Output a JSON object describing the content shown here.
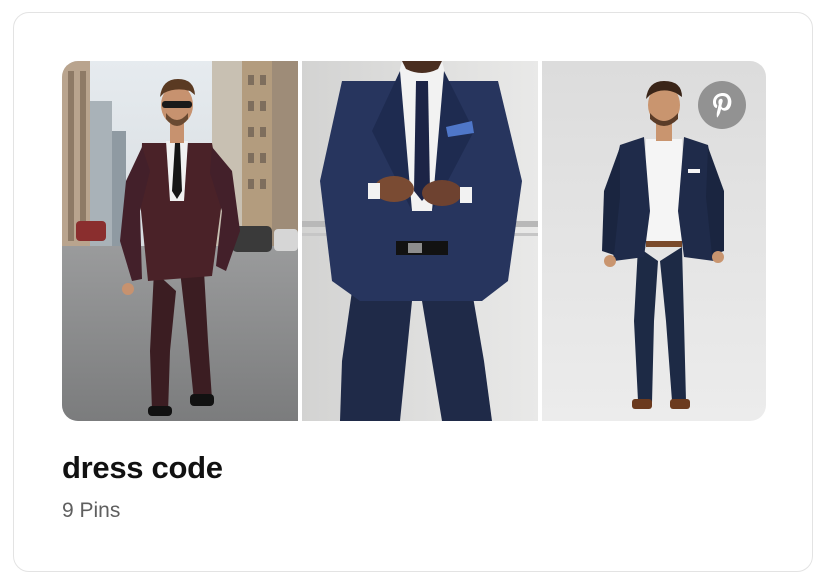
{
  "board": {
    "title": "dress code",
    "pin_count": "9 Pins"
  },
  "images": [
    {
      "icon": "man-in-burgundy-suit-on-street-image"
    },
    {
      "icon": "man-in-navy-suit-buttoning-jacket-image"
    },
    {
      "icon": "man-in-navy-blazer-studio-image"
    }
  ],
  "badge": {
    "icon": "pinterest-logo-icon",
    "color": "#787878"
  },
  "colors": {
    "title": "#111111",
    "subtitle": "#5f5f5f",
    "card_border": "#e3e3e3"
  }
}
